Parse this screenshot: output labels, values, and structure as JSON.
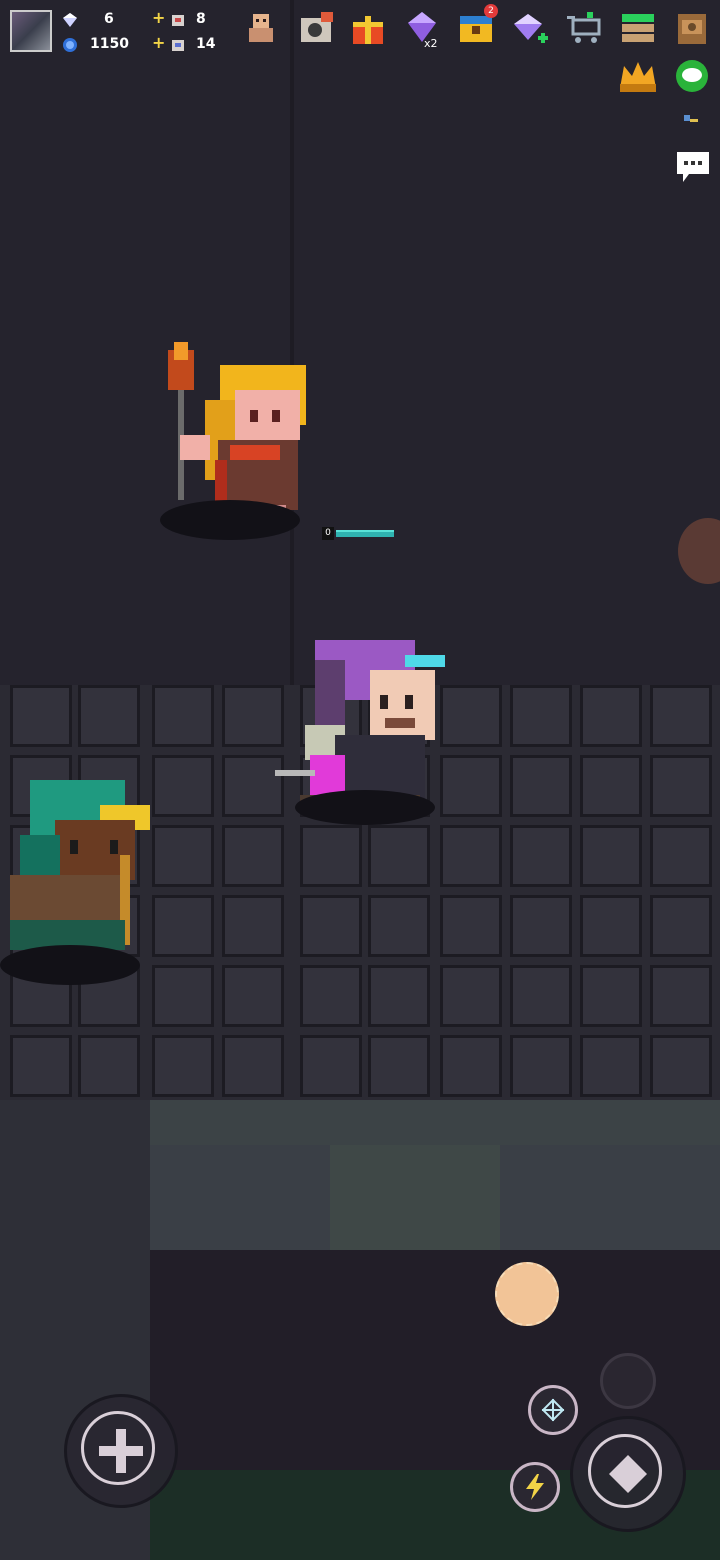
{
  "hud": {
    "gems": "6",
    "coins": "1150",
    "keys_a": "8",
    "keys_b": "14"
  },
  "hud_buttons": [
    {
      "name": "character-icon"
    },
    {
      "name": "camera-icon"
    },
    {
      "name": "gift-icon"
    },
    {
      "name": "gem-x2-icon"
    },
    {
      "name": "treasure-chest-icon",
      "badge": "2"
    },
    {
      "name": "gem-shop-icon"
    },
    {
      "name": "shop-cart-icon"
    },
    {
      "name": "menu-stack-icon"
    },
    {
      "name": "backpack-icon"
    }
  ],
  "player_hp": "0",
  "colors": {
    "floor": "#25232d",
    "tile": "#33323c",
    "hp": "#2fb3b0",
    "accent": "#f2d447"
  }
}
